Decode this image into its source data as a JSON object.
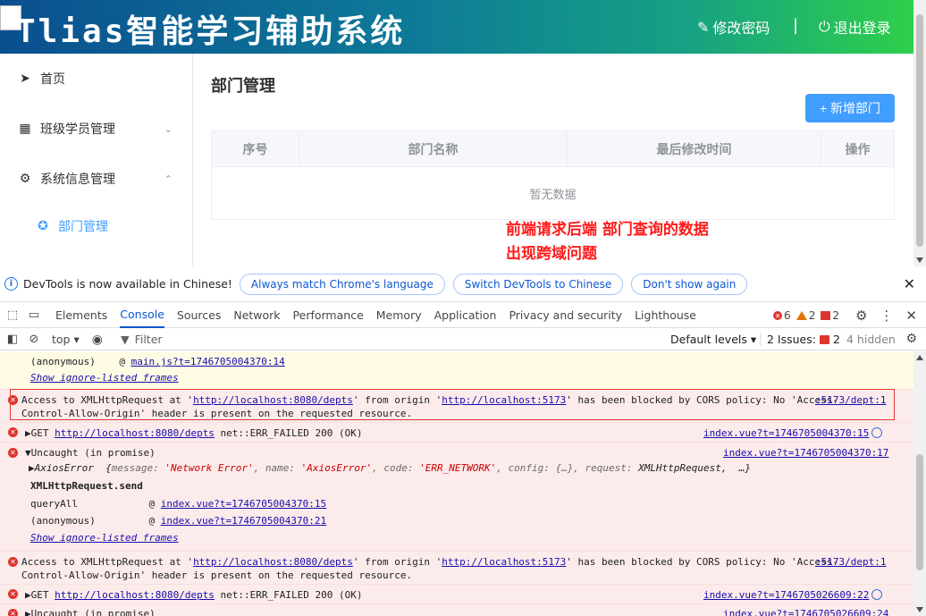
{
  "app": {
    "title": "Tlias智能学习辅助系统",
    "change_password": "修改密码",
    "separator": "|",
    "logout": "退出登录"
  },
  "sidebar": {
    "items": [
      {
        "label": "首页",
        "icon": "send-icon"
      },
      {
        "label": "班级学员管理",
        "icon": "grid-icon",
        "chevron": "⌄"
      },
      {
        "label": "系统信息管理",
        "icon": "gear-icon",
        "chevron": "⌃"
      },
      {
        "label": "部门管理",
        "icon": "dept-icon",
        "active": true
      }
    ]
  },
  "main": {
    "title": "部门管理",
    "add_button": "+ 新增部门",
    "table": {
      "columns": [
        "序号",
        "部门名称",
        "最后修改时间",
        "操作"
      ],
      "empty_text": "暂无数据"
    },
    "annotation_lines": [
      "前端请求后端 部门查询的数据",
      "出现跨域问题"
    ]
  },
  "devtools": {
    "infobar": {
      "message": "DevTools is now available in Chinese!",
      "buttons": [
        "Always match Chrome's language",
        "Switch DevTools to Chinese",
        "Don't show again"
      ]
    },
    "tabs": [
      "Elements",
      "Console",
      "Sources",
      "Network",
      "Performance",
      "Memory",
      "Application",
      "Privacy and security",
      "Lighthouse"
    ],
    "active_tab": "Console",
    "counts": {
      "errors": "6",
      "warnings": "2",
      "issues": "2"
    },
    "filter": {
      "context": "top ▾",
      "placeholder": "Filter",
      "levels": "Default levels ▾",
      "issues_label": "2 Issues:",
      "issues_count": "2",
      "hidden": "4 hidden"
    },
    "console": {
      "anon_line": "(anonymous)    @ ",
      "anon_link": "main.js?t=1746705004370:14",
      "show_ignore": "Show ignore-listed frames",
      "cors_1a_pre": "Access to XMLHttpRequest at '",
      "cors_url1": "http://localhost:8080/depts",
      "cors_1a_mid": "' from origin '",
      "cors_url2": "http://localhost:5173",
      "cors_1a_post": "' has been blocked by CORS policy: No 'Access-",
      "cors_1b": "Control-Allow-Origin' header is present on the requested resource.",
      "cors_src": ":5173/dept:1",
      "get_pre": "▶GET ",
      "get_url": "http://localhost:8080/depts",
      "get_post": " net::ERR_FAILED 200 (OK)",
      "get_src1": "index.vue?t=1746705004370:15",
      "uncaught": "▼Uncaught (in promise)",
      "uncaught_src": "index.vue?t=1746705004370:17",
      "axios_pre": "▶AxiosError  {",
      "axios_k1": "message: ",
      "axios_v1": "'Network Error'",
      "axios_k2": ", name: ",
      "axios_v2": "'AxiosError'",
      "axios_k3": ", code: ",
      "axios_v3": "'ERR_NETWORK'",
      "axios_k4": ", config: {…}, request: ",
      "axios_v4": "XMLHttpRequest",
      "axios_end": ",  …}",
      "xhr_send": "XMLHttpRequest.send",
      "query_all": "queryAll            @ ",
      "query_link": "index.vue?t=1746705004370:15",
      "anon2": "(anonymous)         @ ",
      "anon2_link": "index.vue?t=1746705004370:21",
      "show_ignore2": "Show ignore-listed frames",
      "get_src2": "index.vue?t=1746705026609:22",
      "uncaught2": "▶Uncaught (in promise)",
      "uncaught2_src": "index.vue?t=1746705026609:24"
    }
  }
}
